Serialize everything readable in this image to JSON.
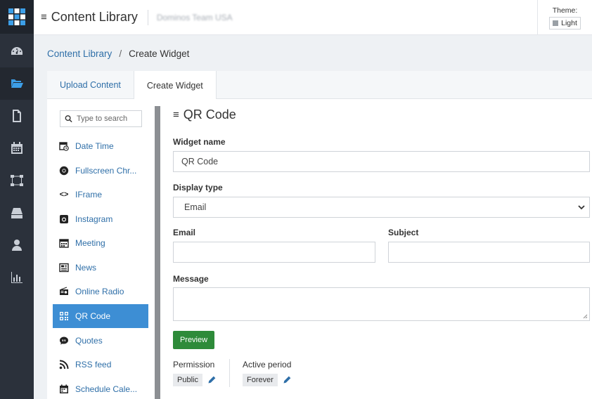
{
  "app": {
    "title": "Content Library",
    "team": "Dominos Team USA",
    "theme_label": "Theme:",
    "theme_value": "Light"
  },
  "rail": {
    "items": [
      "dashboard-icon",
      "folder-open-icon",
      "file-icon",
      "calendar-icon",
      "network-icon",
      "drive-icon",
      "user-icon",
      "bar-chart-icon"
    ],
    "active_index": 1,
    "accent": "#3d9fe8"
  },
  "breadcrumb": {
    "root": "Content Library",
    "separator": "/",
    "current": "Create Widget"
  },
  "tabs": [
    {
      "label": "Upload Content",
      "active": false
    },
    {
      "label": "Create Widget",
      "active": true
    }
  ],
  "widget_list": {
    "search_placeholder": "Type to search",
    "items": [
      {
        "label": "Date Time",
        "icon": "calendar-clock-icon"
      },
      {
        "label": "Fullscreen Chr...",
        "icon": "chrome-icon"
      },
      {
        "label": "IFrame",
        "icon": "code-icon"
      },
      {
        "label": "Instagram",
        "icon": "instagram-icon"
      },
      {
        "label": "Meeting",
        "icon": "calendar-icon"
      },
      {
        "label": "News",
        "icon": "newspaper-icon"
      },
      {
        "label": "Online Radio",
        "icon": "radio-icon"
      },
      {
        "label": "QR Code",
        "icon": "qrcode-icon",
        "active": true
      },
      {
        "label": "Quotes",
        "icon": "quote-bubble-icon"
      },
      {
        "label": "RSS feed",
        "icon": "rss-icon"
      },
      {
        "label": "Schedule Cale...",
        "icon": "schedule-calendar-icon"
      }
    ],
    "active_color": "#3d8ed4"
  },
  "form": {
    "title": "QR Code",
    "widget_name_label": "Widget name",
    "widget_name_value": "QR Code",
    "display_type_label": "Display type",
    "display_type_value": "Email",
    "email_label": "Email",
    "email_value": "",
    "subject_label": "Subject",
    "subject_value": "",
    "message_label": "Message",
    "message_value": "",
    "preview_label": "Preview",
    "preview_color": "#2e8b3a",
    "permission_label": "Permission",
    "permission_value": "Public",
    "active_period_label": "Active period",
    "active_period_value": "Forever"
  }
}
